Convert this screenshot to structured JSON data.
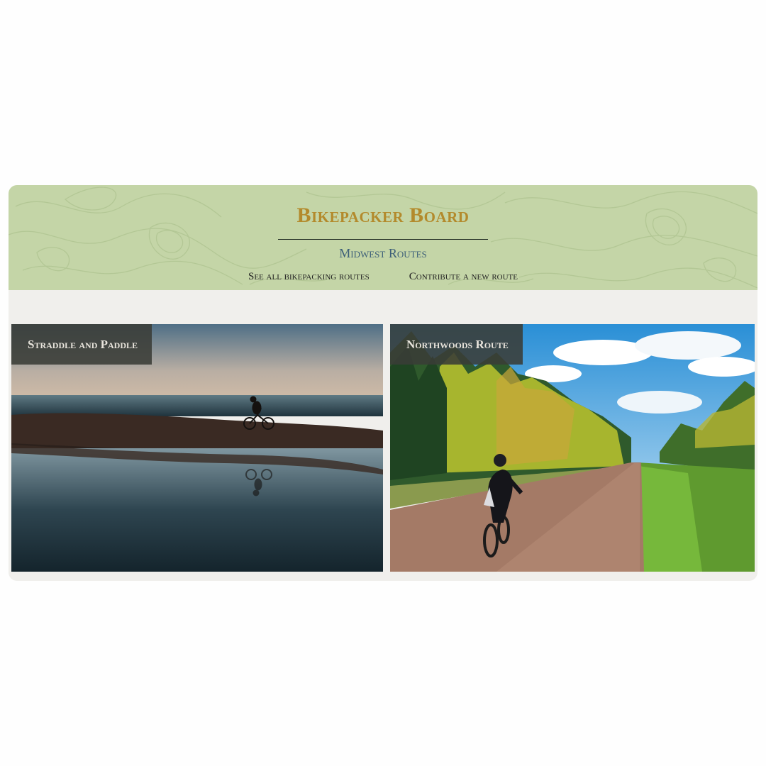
{
  "header": {
    "title": "Bikepacker Board",
    "subtitle": "Midwest Routes",
    "links": [
      {
        "label": "See all bikepacking routes"
      },
      {
        "label": "Contribute a new route"
      }
    ]
  },
  "routes": [
    {
      "title": "Straddle and Paddle",
      "image": "cyclist silhouetted on rocky lakeshore at dusk with reflection in still water"
    },
    {
      "title": "Northwoods Route",
      "image": "cyclist riding a gravel road between autumn forest under blue sky"
    }
  ],
  "colors": {
    "header_bg": "#c4d5a7",
    "title": "#b38a2c",
    "subtitle": "#3d5f78",
    "card_bg": "#f0efec",
    "label_bg": "#3a3c37"
  }
}
